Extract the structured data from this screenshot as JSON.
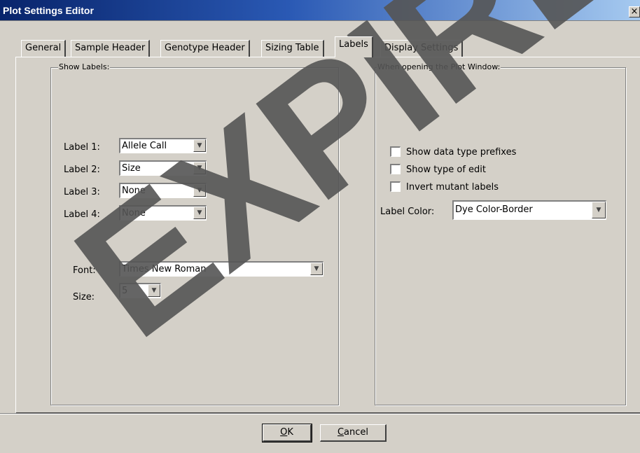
{
  "window": {
    "title": "Plot Settings Editor",
    "close": "×"
  },
  "tabs": [
    {
      "label": "General"
    },
    {
      "label": "Sample Header"
    },
    {
      "label": "Genotype Header"
    },
    {
      "label": "Sizing Table"
    },
    {
      "label": "Labels"
    },
    {
      "label": "Display Settings"
    }
  ],
  "active_tab": "Labels",
  "show_labels": {
    "legend": "Show Labels:",
    "labels": [
      {
        "label": "Label 1:",
        "value": "Allele Call"
      },
      {
        "label": "Label 2:",
        "value": "Size"
      },
      {
        "label": "Label 3:",
        "value": "None"
      },
      {
        "label": "Label 4:",
        "value": "None"
      }
    ],
    "font": {
      "label": "Font:",
      "value": "Times New Roman"
    },
    "size": {
      "label": "Size:",
      "value": "5"
    }
  },
  "plot_window": {
    "legend": "When opening the Plot Window:",
    "checkboxes": [
      {
        "label": "Show data type prefixes",
        "checked": false
      },
      {
        "label": "Show type of edit",
        "checked": false
      },
      {
        "label": "Invert mutant labels",
        "checked": false
      }
    ],
    "label_color": {
      "label": "Label Color:",
      "value": "Dye Color-Border"
    }
  },
  "buttons": {
    "ok": {
      "mnemonic": "O",
      "rest": "K"
    },
    "cancel": {
      "mnemonic": "C",
      "rest": "ancel"
    }
  },
  "watermark": "EXPIRED",
  "icons": {
    "dropdown": "down-triangle",
    "close": "x-mark"
  }
}
